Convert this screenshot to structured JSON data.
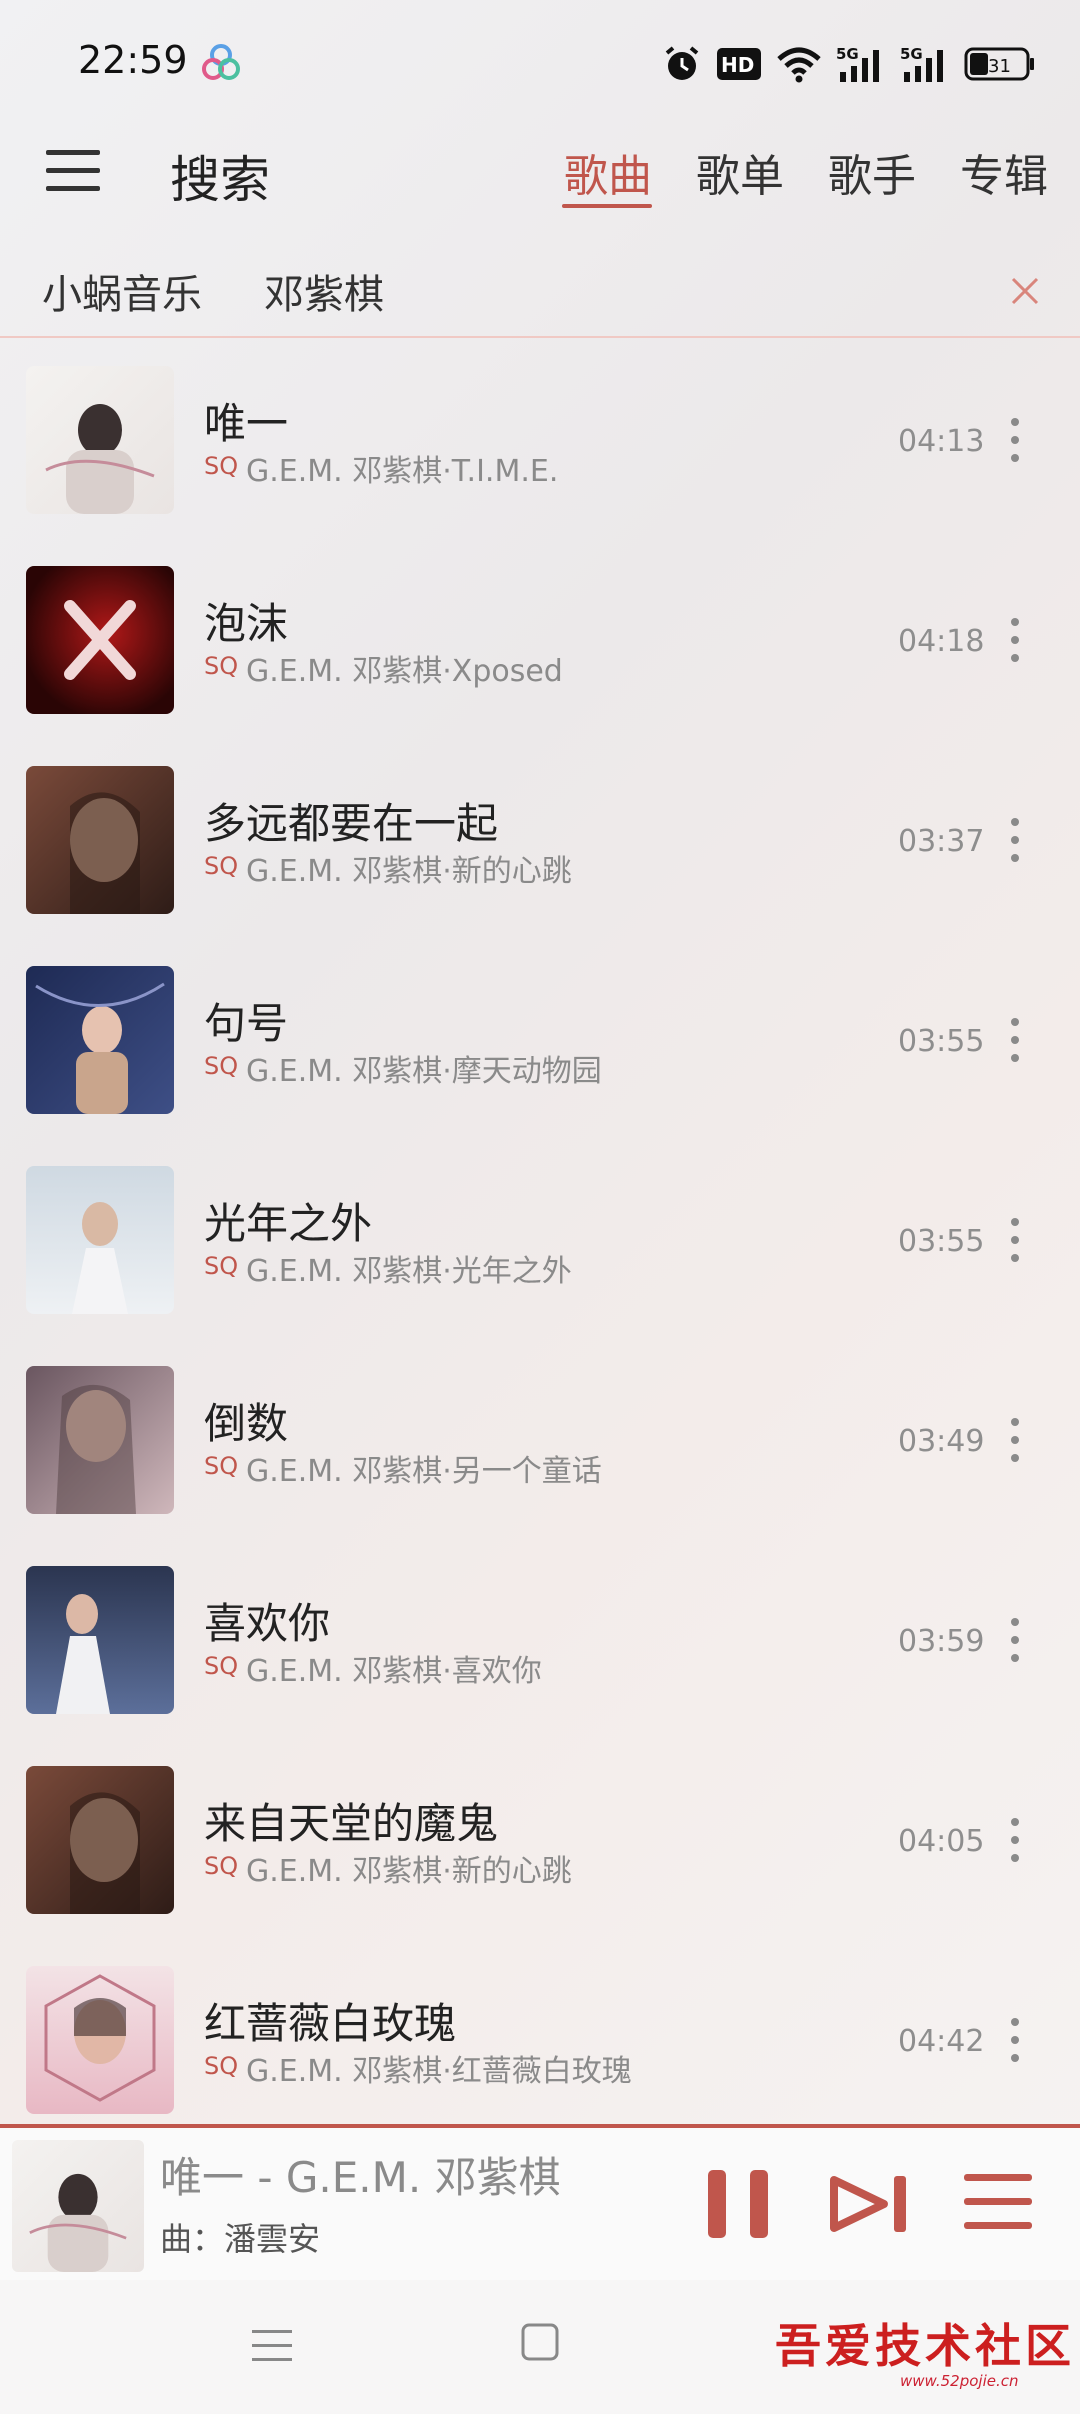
{
  "status": {
    "time": "22:59",
    "battery": "31",
    "network_a": "5G",
    "network_b": "5G",
    "hd": "HD"
  },
  "header": {
    "title": "搜索",
    "tabs": [
      {
        "label": "歌曲",
        "active": true
      },
      {
        "label": "歌单",
        "active": false
      },
      {
        "label": "歌手",
        "active": false
      },
      {
        "label": "专辑",
        "active": false
      }
    ]
  },
  "search": {
    "source": "小蜗音乐",
    "query": "邓紫棋"
  },
  "colors": {
    "accent": "#c0564c"
  },
  "songs": [
    {
      "title": "唯一",
      "quality": "SQ",
      "meta": "G.E.M. 邓紫棋·T.I.M.E.",
      "duration": "04:13"
    },
    {
      "title": "泡沫",
      "quality": "SQ",
      "meta": "G.E.M. 邓紫棋·Xposed",
      "duration": "04:18"
    },
    {
      "title": "多远都要在一起",
      "quality": "SQ",
      "meta": "G.E.M. 邓紫棋·新的心跳",
      "duration": "03:37"
    },
    {
      "title": "句号",
      "quality": "SQ",
      "meta": "G.E.M. 邓紫棋·摩天动物园",
      "duration": "03:55"
    },
    {
      "title": "光年之外",
      "quality": "SQ",
      "meta": "G.E.M. 邓紫棋·光年之外",
      "duration": "03:55"
    },
    {
      "title": "倒数",
      "quality": "SQ",
      "meta": "G.E.M. 邓紫棋·另一个童话",
      "duration": "03:49"
    },
    {
      "title": "喜欢你",
      "quality": "SQ",
      "meta": "G.E.M. 邓紫棋·喜欢你",
      "duration": "03:59"
    },
    {
      "title": "来自天堂的魔鬼",
      "quality": "SQ",
      "meta": "G.E.M. 邓紫棋·新的心跳",
      "duration": "04:05"
    },
    {
      "title": "红蔷薇白玫瑰",
      "quality": "SQ",
      "meta": "G.E.M. 邓紫棋·红蔷薇白玫瑰",
      "duration": "04:42"
    }
  ],
  "player": {
    "title": "唯一 - G.E.M. 邓紫棋",
    "composer": "曲：潘雲安"
  },
  "watermark": {
    "text": "吾爱技术社区",
    "sub": "www.52pojie.cn"
  }
}
